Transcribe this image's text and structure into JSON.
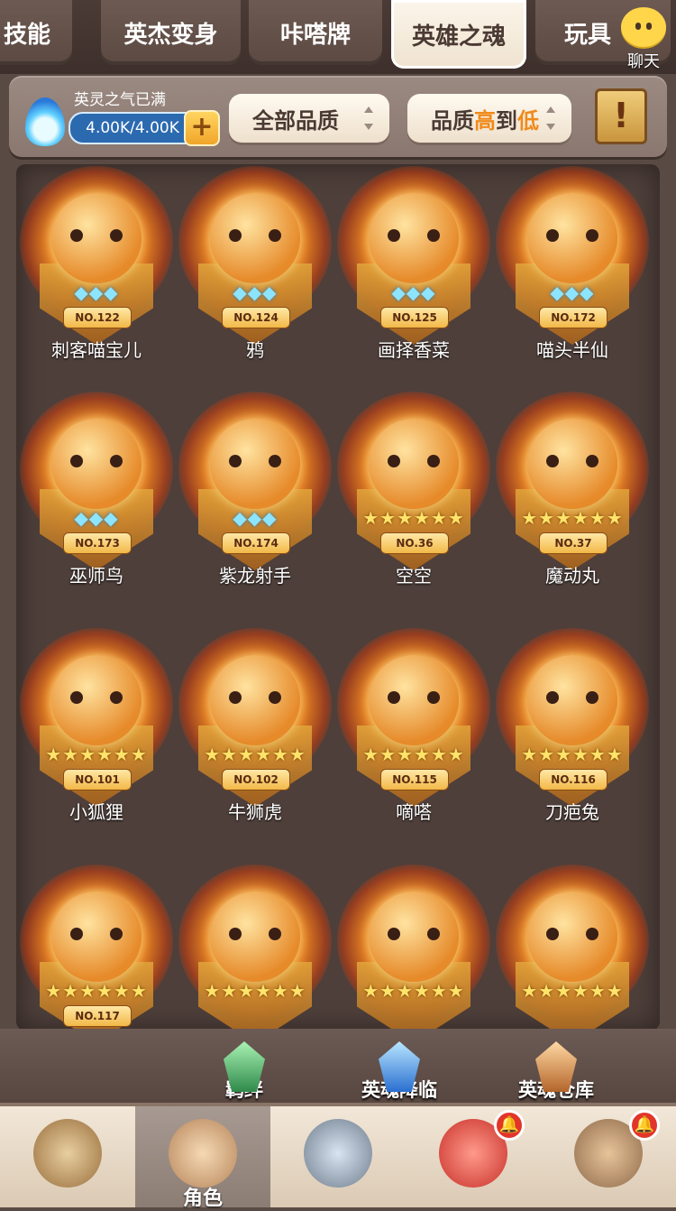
{
  "tabs": [
    {
      "label": "技能",
      "active": false
    },
    {
      "label": "英杰变身",
      "active": false
    },
    {
      "label": "咔嗒牌",
      "active": false
    },
    {
      "label": "英雄之魂",
      "active": true
    },
    {
      "label": "玩具",
      "active": false
    }
  ],
  "chat": {
    "label": "聊天",
    "icon": "chat-smile-icon"
  },
  "energy": {
    "label": "英灵之气已满",
    "value": "4.00K/4.00K",
    "icon": "blue-flame-icon",
    "add_icon": "plus-icon"
  },
  "filters": {
    "quality": "全部品质",
    "sort_prefix": "品质",
    "sort_high": "高",
    "sort_mid": "到",
    "sort_low": "低",
    "info_icon": "scroll-exclamation-icon"
  },
  "heroes": [
    {
      "no": "NO.122",
      "name": "刺客喵宝儿",
      "rank": "◆◆◆",
      "rank_type": "gem"
    },
    {
      "no": "NO.124",
      "name": "鸦",
      "rank": "◆◆◆",
      "rank_type": "gem"
    },
    {
      "no": "NO.125",
      "name": "画择香菜",
      "rank": "◆◆◆",
      "rank_type": "gem"
    },
    {
      "no": "NO.172",
      "name": "喵头半仙",
      "rank": "◆◆◆",
      "rank_type": "gem"
    },
    {
      "no": "NO.173",
      "name": "巫师鸟",
      "rank": "◆◆◆",
      "rank_type": "gem"
    },
    {
      "no": "NO.174",
      "name": "紫龙射手",
      "rank": "◆◆◆",
      "rank_type": "gem"
    },
    {
      "no": "NO.36",
      "name": "空空",
      "rank": "★★★★★★",
      "rank_type": "star"
    },
    {
      "no": "NO.37",
      "name": "魔动丸",
      "rank": "★★★★★★",
      "rank_type": "star"
    },
    {
      "no": "NO.101",
      "name": "小狐狸",
      "rank": "★★★★★★",
      "rank_type": "star"
    },
    {
      "no": "NO.102",
      "name": "牛狮虎",
      "rank": "★★★★★★",
      "rank_type": "star"
    },
    {
      "no": "NO.115",
      "name": "嘀嗒",
      "rank": "★★★★★★",
      "rank_type": "star"
    },
    {
      "no": "NO.116",
      "name": "刀疤兔",
      "rank": "★★★★★★",
      "rank_type": "star"
    },
    {
      "no": "NO.117",
      "name": "",
      "rank": "★★★★★★",
      "rank_type": "star"
    },
    {
      "no": "",
      "name": "",
      "rank": "★★★★★★",
      "rank_type": "star"
    },
    {
      "no": "",
      "name": "",
      "rank": "★★★★★★",
      "rank_type": "star"
    },
    {
      "no": "",
      "name": "",
      "rank": "★★★★★★",
      "rank_type": "star"
    }
  ],
  "actions": [
    {
      "label": "羁绊",
      "icon": "green-crystal-icon",
      "color": "#4fb86a"
    },
    {
      "label": "英魂降临",
      "icon": "blue-crystal-icon",
      "color": "#3c8fe0"
    },
    {
      "label": "英魂仓库",
      "icon": "amber-crystal-icon",
      "color": "#d08a3a"
    }
  ],
  "nav": [
    {
      "label": "",
      "icon": "furry-hero-icon",
      "active": false,
      "badge": false
    },
    {
      "label": "角色",
      "icon": "character-portrait-icon",
      "active": true,
      "badge": false
    },
    {
      "label": "",
      "icon": "sword-shield-icon",
      "active": false,
      "badge": false
    },
    {
      "label": "",
      "icon": "red-dino-pet-icon",
      "active": false,
      "badge": true
    },
    {
      "label": "",
      "icon": "stone-totem-icon",
      "active": false,
      "badge": true
    }
  ],
  "colors": {
    "accent": "#f08a1b",
    "badge": "#e2352a",
    "gem": "#8de4ff",
    "star": "#ffe36a"
  }
}
